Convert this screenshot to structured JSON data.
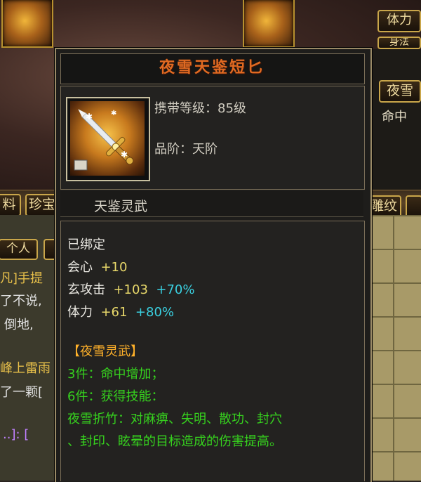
{
  "background": {
    "right_panel": {
      "stat_label": "体力",
      "stat_label_2": "身法",
      "name_tab": "夜雪",
      "stat_label_3": "命中"
    },
    "tabs": {
      "left_tab": "料",
      "tab_2": "珍宝",
      "right_tab": "雕纹",
      "personal_tab": "个人"
    },
    "chat_lines": [
      "凡]手提",
      "了不说,",
      "倒地,",
      "峰上雷雨",
      "了一颗[",
      "..]: ["
    ]
  },
  "tooltip": {
    "item_name": "夜雪天鉴短匕",
    "carry_level_label": "携带等级：",
    "carry_level_value": "85级",
    "grade_label": "品阶：",
    "grade_value": "天阶",
    "set_title": "天鉴灵武",
    "bound_status": "已绑定",
    "stats": [
      {
        "name": "会心",
        "base": "+10",
        "bonus": ""
      },
      {
        "name": "玄攻击",
        "base": "+103",
        "bonus": "+70%"
      },
      {
        "name": "体力",
        "base": "+61",
        "bonus": "+80%"
      }
    ],
    "set_bonus": {
      "name": "【夜雪灵武】",
      "piece3": "3件：命中增加；",
      "piece6": "6件：获得技能：",
      "skill_line1": "夜雪折竹：对麻痹、失明、散功、封穴",
      "skill_line2": "、封印、眩晕的目标造成的伤害提高。"
    }
  },
  "colors": {
    "title": "#e06a22",
    "stat_base": "#e8d86a",
    "stat_bonus": "#3ad0e0",
    "set_effect": "#36d21e",
    "set_name": "#ffb12a"
  }
}
